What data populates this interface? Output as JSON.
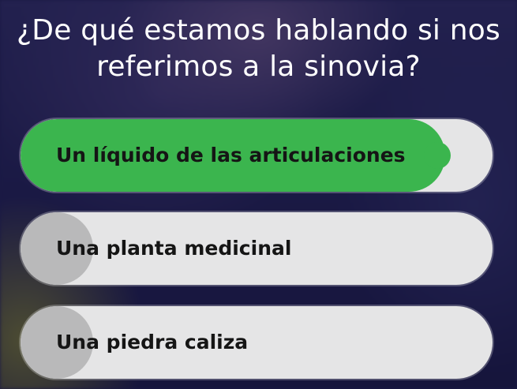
{
  "quiz": {
    "question": "¿De qué estamos hablando si nos referimos a la sinovia?",
    "answers": [
      {
        "label": "Un líquido de las articulaciones",
        "state": "correct",
        "result_fraction": 0.9
      },
      {
        "label": "Una planta medicinal",
        "state": "neutral",
        "result_fraction": 0.0
      },
      {
        "label": "Una piedra caliza",
        "state": "neutral",
        "result_fraction": 0.0
      }
    ]
  },
  "colors": {
    "background": "#1b1a45",
    "correct": "#3bb54e",
    "answer_bg": "#e5e5e6",
    "answer_marker": "#b9b9ba",
    "question_text": "#ffffff",
    "answer_text": "#151515"
  }
}
